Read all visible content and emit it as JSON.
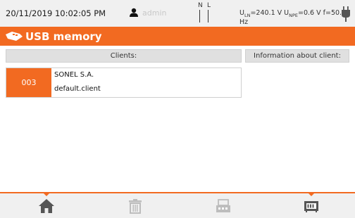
{
  "status_bar": {
    "datetime": "20/11/2019 10:02:05 PM",
    "user": "admin",
    "n_label": "N",
    "l_label": "L",
    "u_ln": "=240.1 V",
    "u_npe": "=0.6 V",
    "frequency": "f=50.0 Hz",
    "u_symbol": "U",
    "ln_sub": "LN",
    "npe_sub": "NPE"
  },
  "title_bar": {
    "title": "USB memory"
  },
  "table": {
    "clients_header": "Clients:",
    "info_header": "Information about client:",
    "rows": [
      {
        "id": "003",
        "name": "SONEL S.A.",
        "file": "default.client"
      }
    ]
  },
  "icons": {
    "user": "user-icon",
    "plug": "plug-icon",
    "title": "usb-memory-icon",
    "home": "home-icon",
    "delete": "trash-icon",
    "transfer": "transfer-icon",
    "memory": "memory-card-icon"
  },
  "colors": {
    "accent": "#f26a21",
    "bar_bg": "#f0f0f0",
    "header_bg": "#e0e0e0",
    "icon_dark": "#555555",
    "icon_light": "#bdbdbd"
  }
}
